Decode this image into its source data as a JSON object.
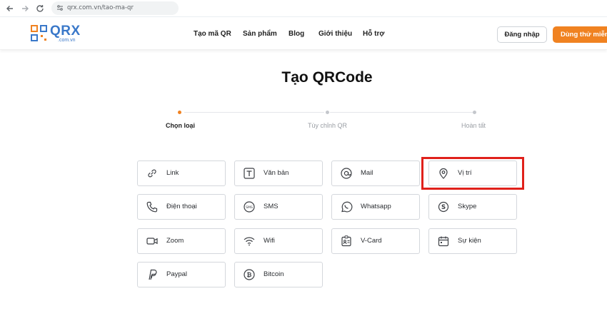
{
  "browser": {
    "url": "qrx.com.vn/tao-ma-qr",
    "back_icon": "arrow-left-icon",
    "forward_icon": "arrow-right-icon",
    "reload_icon": "reload-icon"
  },
  "header": {
    "logo_text": "QRX",
    "logo_sub": ".com.vn",
    "menu": [
      "Tạo mã QR",
      "Sản phẩm",
      "Blog",
      "Giới thiệu",
      "Hỗ trợ"
    ],
    "login_label": "Đăng nhập",
    "try_label": "Dùng thử miễn phí",
    "accent": "#f08221",
    "brand": "#3a78c9"
  },
  "page": {
    "title": "Tạo QRCode"
  },
  "steps": [
    {
      "label": "Chọn loại",
      "active": true
    },
    {
      "label": "Tùy chỉnh QR",
      "active": false
    },
    {
      "label": "Hoàn tất",
      "active": false
    }
  ],
  "types": [
    {
      "label": "Link",
      "icon": "link-icon"
    },
    {
      "label": "Văn bản",
      "icon": "text-icon"
    },
    {
      "label": "Mail",
      "icon": "at-icon"
    },
    {
      "label": "Vị trí",
      "icon": "location-pin-icon",
      "highlighted": true
    },
    {
      "label": "Điện thoại",
      "icon": "phone-icon"
    },
    {
      "label": "SMS",
      "icon": "sms-icon"
    },
    {
      "label": "Whatsapp",
      "icon": "whatsapp-icon"
    },
    {
      "label": "Skype",
      "icon": "skype-icon"
    },
    {
      "label": "Zoom",
      "icon": "video-camera-icon"
    },
    {
      "label": "Wifi",
      "icon": "wifi-icon"
    },
    {
      "label": "V-Card",
      "icon": "contact-card-icon"
    },
    {
      "label": "Sự kiện",
      "icon": "calendar-icon"
    },
    {
      "label": "Paypal",
      "icon": "paypal-icon"
    },
    {
      "label": "Bitcoin",
      "icon": "bitcoin-icon"
    }
  ]
}
